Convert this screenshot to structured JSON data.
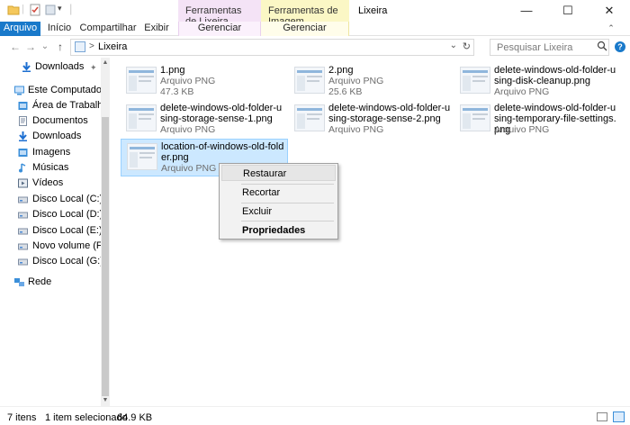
{
  "title": {
    "ferramentas_lixeira": "Ferramentas de Lixeira",
    "ferramentas_imagem": "Ferramentas de Imagem",
    "window_title": "Lixeira",
    "minimize": "—",
    "maximize": "☐",
    "close": "✕"
  },
  "ribbon": {
    "arquivo": "Arquivo",
    "inicio": "Início",
    "compartilhar": "Compartilhar",
    "exibir": "Exibir",
    "gerenciar1": "Gerenciar",
    "gerenciar2": "Gerenciar",
    "collapse": "⌃"
  },
  "nav": {
    "back": "←",
    "forward": "→",
    "recent": "⌄",
    "up": "↑",
    "address": "Lixeira",
    "address_sep": ">",
    "address_chevron": "⌄",
    "refresh": "↻",
    "search_placeholder": "Pesquisar Lixeira",
    "help": "?"
  },
  "sidebar": {
    "items": [
      {
        "label": "Downloads",
        "icon": "download-arrow-icon",
        "color": "#1d6fd1"
      },
      {
        "label": "Este Computador",
        "icon": "computer-icon",
        "color": "#3b8fd9"
      },
      {
        "label": "Área de Trabalho",
        "icon": "desktop-icon",
        "color": "#3b8fd9"
      },
      {
        "label": "Documentos",
        "icon": "documents-icon",
        "color": "#7f8ea3"
      },
      {
        "label": "Downloads",
        "icon": "download-arrow-icon",
        "color": "#1d6fd1"
      },
      {
        "label": "Imagens",
        "icon": "pictures-icon",
        "color": "#3b8fd9"
      },
      {
        "label": "Músicas",
        "icon": "music-icon",
        "color": "#3b8fd9"
      },
      {
        "label": "Vídeos",
        "icon": "videos-icon",
        "color": "#5a6e86"
      },
      {
        "label": "Disco Local (C:)",
        "icon": "drive-icon",
        "color": "#7f8ea3"
      },
      {
        "label": "Disco Local (D:)",
        "icon": "drive-icon",
        "color": "#7f8ea3"
      },
      {
        "label": "Disco Local (E:)",
        "icon": "drive-icon",
        "color": "#7f8ea3"
      },
      {
        "label": "Novo volume (F:)",
        "icon": "drive-icon",
        "color": "#7f8ea3"
      },
      {
        "label": "Disco Local (G:)",
        "icon": "drive-icon",
        "color": "#7f8ea3"
      },
      {
        "label": "Rede",
        "icon": "network-icon",
        "color": "#3b8fd9"
      }
    ],
    "pin": "📌"
  },
  "files": [
    {
      "name": "1.png",
      "type": "Arquivo PNG",
      "size": "47.3 KB",
      "selected": false
    },
    {
      "name": "2.png",
      "type": "Arquivo PNG",
      "size": "25.6 KB",
      "selected": false
    },
    {
      "name": "delete-windows-old-folder-using-disk-cleanup.png",
      "type": "Arquivo PNG",
      "size": "",
      "selected": false
    },
    {
      "name": "delete-windows-old-folder-using-storage-sense-1.png",
      "type": "Arquivo PNG",
      "size": "",
      "selected": false
    },
    {
      "name": "delete-windows-old-folder-using-storage-sense-2.png",
      "type": "Arquivo PNG",
      "size": "",
      "selected": false
    },
    {
      "name": "delete-windows-old-folder-using-temporary-file-settings.png",
      "type": "Arquivo PNG",
      "size": "",
      "selected": false
    },
    {
      "name": "location-of-windows-old-folder.png",
      "type": "Arquivo PNG",
      "size": "",
      "selected": true
    }
  ],
  "context_menu": {
    "restaurar": "Restaurar",
    "recortar": "Recortar",
    "excluir": "Excluir",
    "propriedades": "Propriedades"
  },
  "status": {
    "items": "7 itens",
    "selected": "1 item selecionado",
    "size": "64.9 KB"
  },
  "colors": {
    "accent": "#1979ca",
    "selection": "#cce8ff"
  }
}
